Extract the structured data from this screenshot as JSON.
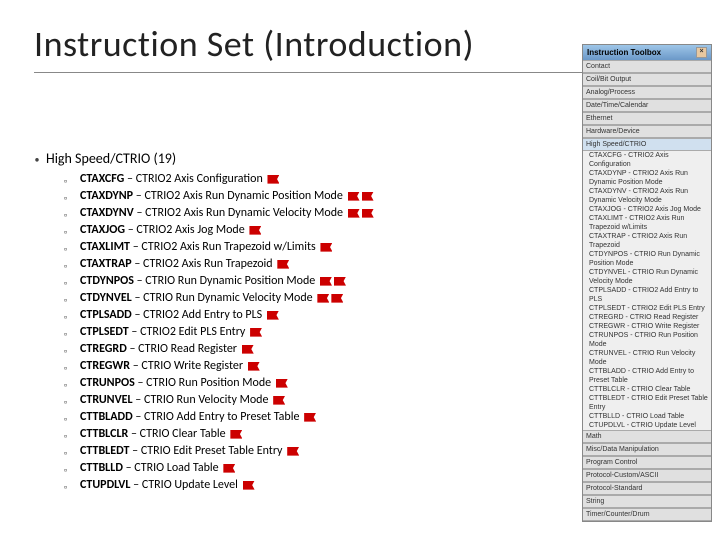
{
  "title": "Instruction Set (Introduction)",
  "category": "High Speed/CTRIO (19)",
  "instructions": [
    {
      "mn": "CTAXCFG",
      "desc": "– CTRIO2 Axis Configuration",
      "flags": 1
    },
    {
      "mn": "CTAXDYNP",
      "desc": "– CTRIO2 Axis Run Dynamic Position Mode",
      "flags": 2
    },
    {
      "mn": "CTAXDYNV",
      "desc": "– CTRIO2 Axis Run Dynamic Velocity Mode",
      "flags": 2
    },
    {
      "mn": "CTAXJOG",
      "desc": "– CTRIO2 Axis Jog Mode",
      "flags": 1
    },
    {
      "mn": "CTAXLIMT",
      "desc": "– CTRIO2 Axis Run Trapezoid w/Limits",
      "flags": 1
    },
    {
      "mn": "CTAXTRAP",
      "desc": "– CTRIO2 Axis Run Trapezoid",
      "flags": 1
    },
    {
      "mn": "CTDYNPOS",
      "desc": "– CTRIO Run Dynamic Position Mode",
      "flags": 2
    },
    {
      "mn": "CTDYNVEL",
      "desc": "– CTRIO Run Dynamic Velocity Mode",
      "flags": 2
    },
    {
      "mn": "CTPLSADD",
      "desc": "– CTRIO2 Add Entry to PLS",
      "flags": 1
    },
    {
      "mn": "CTPLSEDT",
      "desc": "– CTRIO2 Edit PLS Entry",
      "flags": 1
    },
    {
      "mn": "CTREGRD",
      "desc": "– CTRIO Read Register",
      "flags": 1
    },
    {
      "mn": "CTREGWR",
      "desc": "– CTRIO Write Register",
      "flags": 1
    },
    {
      "mn": "CTRUNPOS",
      "desc": "– CTRIO Run Position Mode",
      "flags": 1
    },
    {
      "mn": "CTRUNVEL",
      "desc": "– CTRIO Run Velocity Mode",
      "flags": 1
    },
    {
      "mn": "CTTBLADD",
      "desc": "– CTRIO Add Entry to Preset Table",
      "flags": 1
    },
    {
      "mn": "CTTBLCLR",
      "desc": "– CTRIO Clear Table",
      "flags": 1
    },
    {
      "mn": "CTTBLEDT",
      "desc": "– CTRIO Edit Preset Table Entry",
      "flags": 1
    },
    {
      "mn": "CTTBLLD",
      "desc": "– CTRIO Load Table",
      "flags": 1
    },
    {
      "mn": "CTUPDLVL",
      "desc": "– CTRIO Update Level",
      "flags": 1
    }
  ],
  "toolbox": {
    "title": "Instruction Toolbox",
    "sections": [
      {
        "label": "Contact",
        "items": []
      },
      {
        "label": "Coil/Bit Output",
        "items": []
      },
      {
        "label": "Analog/Process",
        "items": []
      },
      {
        "label": "Date/Time/Calendar",
        "items": []
      },
      {
        "label": "Ethernet",
        "items": []
      },
      {
        "label": "Hardware/Device",
        "items": []
      },
      {
        "label": "High Speed/CTRIO",
        "selected": true,
        "items": [
          "CTAXCFG - CTRIO2 Axis Configuration",
          "CTAXDYNP - CTRIO2 Axis Run Dynamic Position Mode",
          "CTAXDYNV - CTRIO2 Axis Run Dynamic Velocity Mode",
          "CTAXJOG - CTRIO2 Axis Jog Mode",
          "CTAXLIMT - CTRIO2 Axis Run Trapezoid w/Limits",
          "CTAXTRAP - CTRIO2 Axis Run Trapezoid",
          "CTDYNPOS - CTRIO Run Dynamic Position Mode",
          "CTDYNVEL - CTRIO Run Dynamic Velocity Mode",
          "CTPLSADD - CTRIO2 Add Entry to PLS",
          "CTPLSEDT - CTRIO2 Edit PLS Entry",
          "CTREGRD - CTRIO Read Register",
          "CTREGWR - CTRIO Write Register",
          "CTRUNPOS - CTRIO Run Position Mode",
          "CTRUNVEL - CTRIO Run Velocity Mode",
          "CTTBLADD - CTRIO Add Entry to Preset Table",
          "CTTBLCLR - CTRIO Clear Table",
          "CTTBLEDT - CTRIO Edit Preset Table Entry",
          "CTTBLLD - CTRIO Load Table",
          "CTUPDLVL - CTRIO Update Level"
        ]
      },
      {
        "label": "Math",
        "items": []
      },
      {
        "label": "Misc/Data Manipulation",
        "items": []
      },
      {
        "label": "Program Control",
        "items": []
      },
      {
        "label": "Protocol-Custom/ASCII",
        "items": []
      },
      {
        "label": "Protocol-Standard",
        "items": []
      },
      {
        "label": "String",
        "items": []
      },
      {
        "label": "Timer/Counter/Drum",
        "items": []
      }
    ]
  }
}
